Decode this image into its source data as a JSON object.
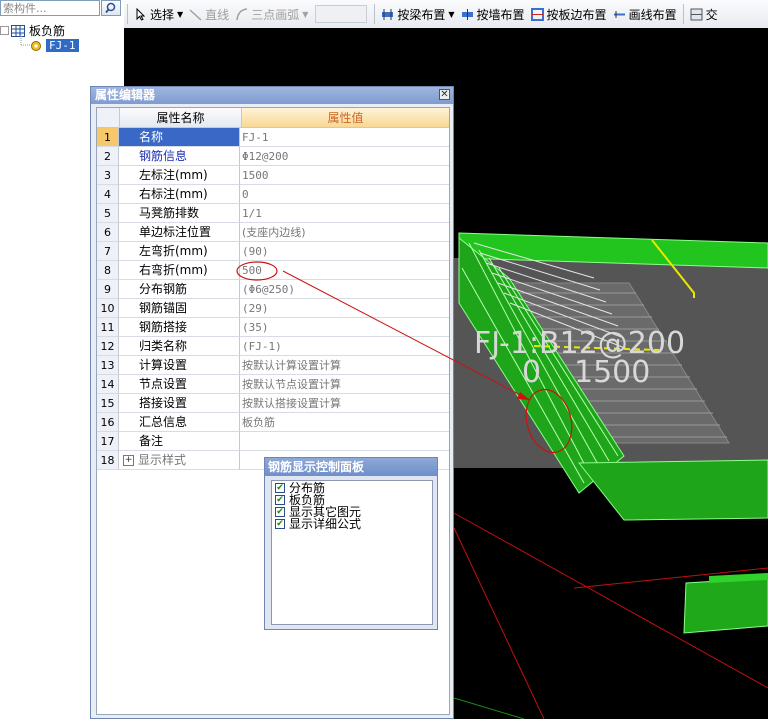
{
  "left_tree": {
    "search_placeholder": "索构件...",
    "root_label": "板负筋",
    "child_label": "FJ-1"
  },
  "toolbar": {
    "select_label": "选择",
    "line_label": "直线",
    "arc_label": "三点画弧",
    "beam_layout_label": "按梁布置",
    "wall_layout_label": "按墙布置",
    "slab_edge_layout_label": "按板边布置",
    "draw_line_layout_label": "画线布置",
    "cross_label": "交"
  },
  "property_editor": {
    "title": "属性编辑器",
    "header_name": "属性名称",
    "header_value": "属性值",
    "rows": [
      {
        "num": "1",
        "name": "名称",
        "value": "FJ-1"
      },
      {
        "num": "2",
        "name": "钢筋信息",
        "value": "Φ12@200"
      },
      {
        "num": "3",
        "name": "左标注(mm)",
        "value": "1500"
      },
      {
        "num": "4",
        "name": "右标注(mm)",
        "value": "0"
      },
      {
        "num": "5",
        "name": "马凳筋排数",
        "value": "1/1"
      },
      {
        "num": "6",
        "name": "单边标注位置",
        "value": "(支座内边线)"
      },
      {
        "num": "7",
        "name": "左弯折(mm)",
        "value": "(90)"
      },
      {
        "num": "8",
        "name": "右弯折(mm)",
        "value": "500"
      },
      {
        "num": "9",
        "name": "分布钢筋",
        "value": "(Φ6@250)"
      },
      {
        "num": "10",
        "name": "钢筋锚固",
        "value": "(29)"
      },
      {
        "num": "11",
        "name": "钢筋搭接",
        "value": "(35)"
      },
      {
        "num": "12",
        "name": "归类名称",
        "value": "(FJ-1)"
      },
      {
        "num": "13",
        "name": "计算设置",
        "value": "按默认计算设置计算"
      },
      {
        "num": "14",
        "name": "节点设置",
        "value": "按默认节点设置计算"
      },
      {
        "num": "15",
        "name": "搭接设置",
        "value": "按默认搭接设置计算"
      },
      {
        "num": "16",
        "name": "汇总信息",
        "value": "板负筋"
      },
      {
        "num": "17",
        "name": "备注",
        "value": ""
      },
      {
        "num": "18",
        "name": "显示样式",
        "value": ""
      }
    ]
  },
  "control_panel": {
    "title": "钢筋显示控制面板",
    "items": [
      {
        "label": "分布筋",
        "checked": true
      },
      {
        "label": "板负筋",
        "checked": true
      },
      {
        "label": "显示其它图元",
        "checked": true
      },
      {
        "label": "显示详细公式",
        "checked": true
      }
    ]
  },
  "viewport": {
    "annotation_main": "FJ-1:B12@200",
    "annotation_left": "0",
    "annotation_right": "1500"
  },
  "colors": {
    "slab_green": "#22c41e",
    "selection_blue": "#3a68c6",
    "callout_red": "#cc1111"
  }
}
